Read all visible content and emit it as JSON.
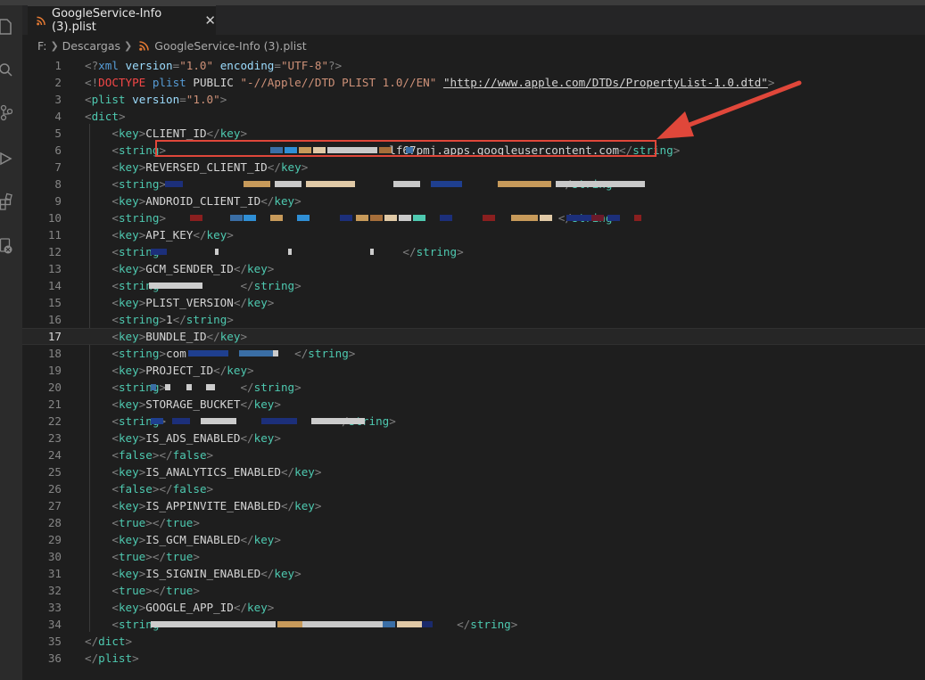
{
  "tab": {
    "title": "GoogleService-Info (3).plist",
    "close": "✕"
  },
  "breadcrumb": {
    "drive": "F:",
    "folder": "Descargas",
    "file": "GoogleService-Info (3).plist"
  },
  "lines": [
    {
      "n": "1"
    },
    {
      "n": "2"
    },
    {
      "n": "3"
    },
    {
      "n": "4"
    },
    {
      "n": "5"
    },
    {
      "n": "6"
    },
    {
      "n": "7"
    },
    {
      "n": "8"
    },
    {
      "n": "9"
    },
    {
      "n": "10"
    },
    {
      "n": "11"
    },
    {
      "n": "12"
    },
    {
      "n": "13"
    },
    {
      "n": "14"
    },
    {
      "n": "15"
    },
    {
      "n": "16"
    },
    {
      "n": "17"
    },
    {
      "n": "18"
    },
    {
      "n": "19"
    },
    {
      "n": "20"
    },
    {
      "n": "21"
    },
    {
      "n": "22"
    },
    {
      "n": "23"
    },
    {
      "n": "24"
    },
    {
      "n": "25"
    },
    {
      "n": "26"
    },
    {
      "n": "27"
    },
    {
      "n": "28"
    },
    {
      "n": "29"
    },
    {
      "n": "30"
    },
    {
      "n": "31"
    },
    {
      "n": "32"
    },
    {
      "n": "33"
    },
    {
      "n": "34"
    },
    {
      "n": "35"
    },
    {
      "n": "36"
    }
  ],
  "code": {
    "xml_decl": {
      "open": "<?",
      "name": "xml",
      "version_attr": "version",
      "version_val": "\"1.0\"",
      "encoding_attr": "encoding",
      "encoding_val": "\"UTF-8\"",
      "close": "?>"
    },
    "doctype": {
      "open": "<!",
      "word": "DOCTYPE",
      "name": "plist",
      "public": "PUBLIC",
      "id": "\"-//Apple//DTD PLIST 1.0//EN\"",
      "url": "\"http://www.apple.com/DTDs/PropertyList-1.0.dtd\"",
      "close": ">"
    },
    "plist_open": {
      "name": "plist",
      "attr": "version",
      "val": "\"1.0\""
    },
    "dict": "dict",
    "plist": "plist",
    "key": "key",
    "string": "string",
    "false": "false",
    "true": "true",
    "keys": {
      "client_id": "CLIENT_ID",
      "reversed_client_id": "REVERSED_CLIENT_ID",
      "android_client_id": "ANDROID_CLIENT_ID",
      "api_key": "API_KEY",
      "gcm_sender_id": "GCM_SENDER_ID",
      "plist_version": "PLIST_VERSION",
      "bundle_id": "BUNDLE_ID",
      "project_id": "PROJECT_ID",
      "storage_bucket": "STORAGE_BUCKET",
      "is_ads_enabled": "IS_ADS_ENABLED",
      "is_analytics_enabled": "IS_ANALYTICS_ENABLED",
      "is_appinvite_enabled": "IS_APPINVITE_ENABLED",
      "is_gcm_enabled": "IS_GCM_ENABLED",
      "is_signin_enabled": "IS_SIGNIN_ENABLED",
      "google_app_id": "GOOGLE_APP_ID"
    },
    "values": {
      "client_id_visible": "lf67pmj.apps.googleusercontent.com",
      "plist_version": "1",
      "bundle_prefix": "com"
    }
  },
  "colors": {
    "annotation_red": "#e0473a",
    "redaction_palette": [
      "#3a6ea5",
      "#2f8fd6",
      "#c79a5a",
      "#e0c9a6",
      "#c9c9c9",
      "#a56e3a",
      "#1c2f7a",
      "#1f3f8f",
      "#8a1f1f",
      "#6a1a2a",
      "#4ec9b0",
      "#7fd6c6",
      "#1a2a6c"
    ]
  },
  "icons": [
    "explorer-icon",
    "search-icon",
    "source-control-icon",
    "run-debug-icon",
    "extensions-icon",
    "remote-icon",
    "rss-file-icon",
    "close-icon",
    "arrow-annotation"
  ]
}
